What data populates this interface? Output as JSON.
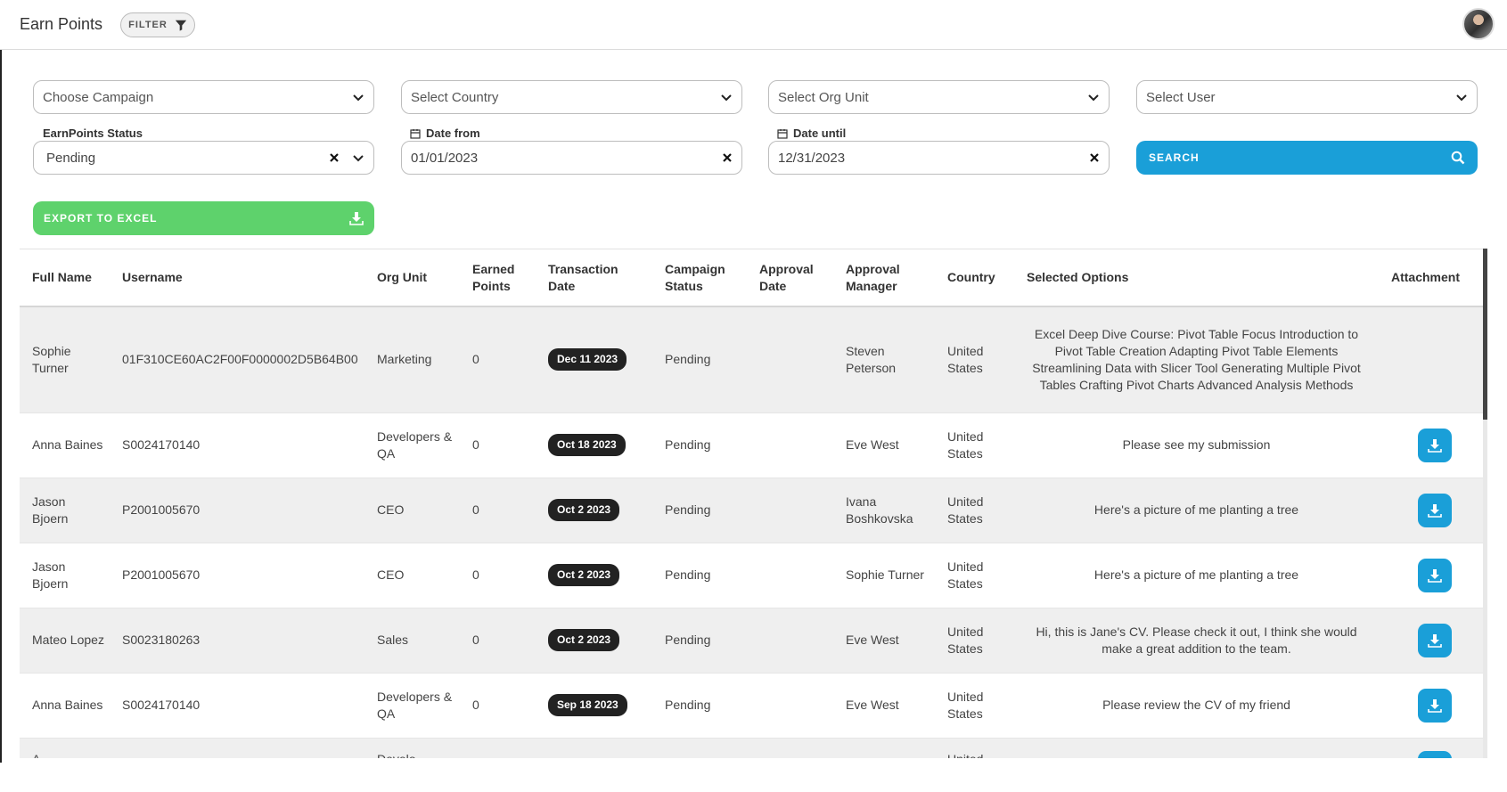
{
  "header": {
    "title": "Earn Points",
    "filter_label": "FILTER"
  },
  "filters": {
    "campaign": {
      "placeholder": "Choose Campaign"
    },
    "country": {
      "placeholder": "Select Country"
    },
    "org_unit": {
      "placeholder": "Select Org Unit"
    },
    "user": {
      "placeholder": "Select User"
    },
    "status": {
      "label": "EarnPoints Status",
      "value": "Pending"
    },
    "date_from": {
      "label": "Date from",
      "value": "01/01/2023"
    },
    "date_until": {
      "label": "Date until",
      "value": "12/31/2023"
    }
  },
  "buttons": {
    "search": "SEARCH",
    "export": "EXPORT TO EXCEL"
  },
  "table": {
    "headers": {
      "full_name": "Full Name",
      "username": "Username",
      "org_unit": "Org Unit",
      "earned_points": "Earned Points",
      "transaction_date": "Transaction Date",
      "campaign_status": "Campaign Status",
      "approval_date": "Approval Date",
      "approval_manager": "Approval Manager",
      "country": "Country",
      "selected_options": "Selected Options",
      "attachment": "Attachment"
    },
    "rows": [
      {
        "full_name": "Sophie Turner",
        "username": "01F310CE60AC2F00F0000002D5B64B00",
        "org_unit": "Marketing",
        "points": "0",
        "date": "Dec 11 2023",
        "status": "Pending",
        "approval_date": "",
        "manager": "Steven Peterson",
        "country": "United States",
        "options": "Excel Deep Dive Course: Pivot Table Focus Introduction to Pivot Table Creation Adapting Pivot Table Elements Streamlining Data with Slicer Tool Generating Multiple Pivot Tables Crafting Pivot Charts Advanced Analysis Methods"
      },
      {
        "full_name": "Anna Baines",
        "username": "S0024170140",
        "org_unit": "Developers & QA",
        "points": "0",
        "date": "Oct 18 2023",
        "status": "Pending",
        "approval_date": "",
        "manager": "Eve West",
        "country": "United States",
        "options": "Please see my submission"
      },
      {
        "full_name": "Jason Bjoern",
        "username": "P2001005670",
        "org_unit": "CEO",
        "points": "0",
        "date": "Oct 2 2023",
        "status": "Pending",
        "approval_date": "",
        "manager": "Ivana Boshkovska",
        "country": "United States",
        "options": "Here's a picture of me planting a tree"
      },
      {
        "full_name": "Jason Bjoern",
        "username": "P2001005670",
        "org_unit": "CEO",
        "points": "0",
        "date": "Oct 2 2023",
        "status": "Pending",
        "approval_date": "",
        "manager": "Sophie Turner",
        "country": "United States",
        "options": "Here's a picture of me planting a tree"
      },
      {
        "full_name": "Mateo Lopez",
        "username": "S0023180263",
        "org_unit": "Sales",
        "points": "0",
        "date": "Oct 2 2023",
        "status": "Pending",
        "approval_date": "",
        "manager": "Eve West",
        "country": "United States",
        "options": "Hi, this is Jane's CV. Please check it out, I think she would make a great addition to the team."
      },
      {
        "full_name": "Anna Baines",
        "username": "S0024170140",
        "org_unit": "Developers & QA",
        "points": "0",
        "date": "Sep 18 2023",
        "status": "Pending",
        "approval_date": "",
        "manager": "Eve West",
        "country": "United States",
        "options": "Please review the CV of my friend"
      },
      {
        "full_name": "A",
        "username": "",
        "org_unit": "Develo",
        "points": "",
        "date": "",
        "status": "",
        "approval_date": "",
        "manager": "",
        "country": "United",
        "options": ""
      }
    ]
  }
}
